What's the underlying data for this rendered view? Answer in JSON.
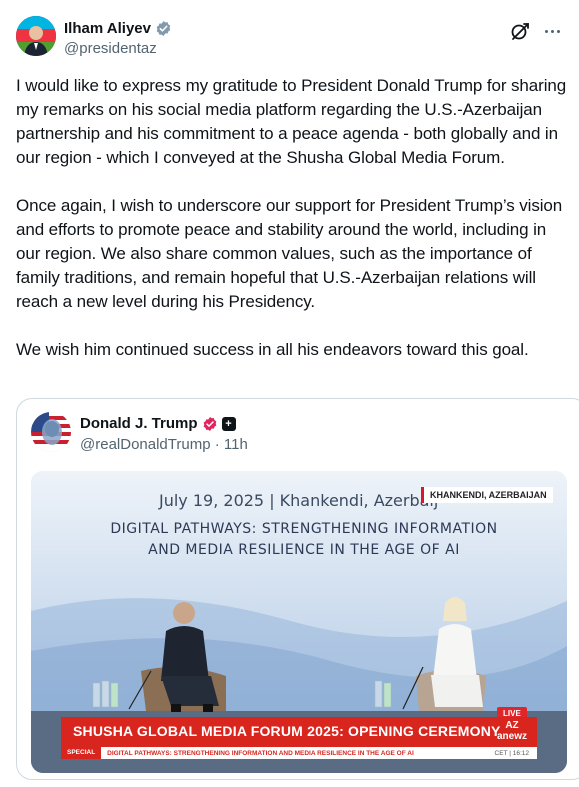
{
  "post": {
    "author_name": "Ilham Aliyev",
    "author_handle": "@presidentaz",
    "paragraphs": [
      "I would like to express my gratitude to President Donald Trump for sharing my remarks on his social media platform regarding the U.S.-Azerbaijan partnership and his commitment to a peace agenda - both globally and in our region - which I conveyed at the Shusha Global Media Forum.",
      "Once again, I wish to underscore our support for President Trump’s vision and efforts to promote peace and stability around the world, including in our region. We also share common values, such as the importance of family traditions, and remain hopeful that U.S.-Azerbaijan relations will reach a new level during his Presidency.",
      "We wish him continued success in all his endeavors toward this goal."
    ],
    "icons": [
      "verified-badge-icon",
      "grok-icon",
      "more-icon"
    ]
  },
  "quoted": {
    "author_name": "Donald J. Trump",
    "author_handle": "@realDonaldTrump",
    "separator": "·",
    "age": "11h",
    "affiliate_mark": "+",
    "media": {
      "date_line": "July 19, 2025 | Khankendi, Azerbaij",
      "location_tag": "KHANKENDI, AZERBAIJAN",
      "headline_1": "DIGITAL PATHWAYS: STRENGTHENING INFORMATION",
      "headline_2": "AND MEDIA RESILIENCE IN THE AGE OF AI",
      "live_label": "LIVE",
      "banner": "SHUSHA GLOBAL MEDIA FORUM 2025: OPENING CEREMONY",
      "logo": "AZ",
      "logo_sub": "anewz",
      "ticker_label": "SPECIAL",
      "ticker_text": "DIGITAL PATHWAYS: STRENGTHENING INFORMATION AND MEDIA RESILIENCE IN THE AGE OF AI",
      "time_text": "CET | 16:12"
    }
  },
  "colors": {
    "text": "#0f1419",
    "secondary": "#536471",
    "verified_blue": "#1d9bf0",
    "border": "#cfd9de",
    "news_red": "#d8261f"
  }
}
